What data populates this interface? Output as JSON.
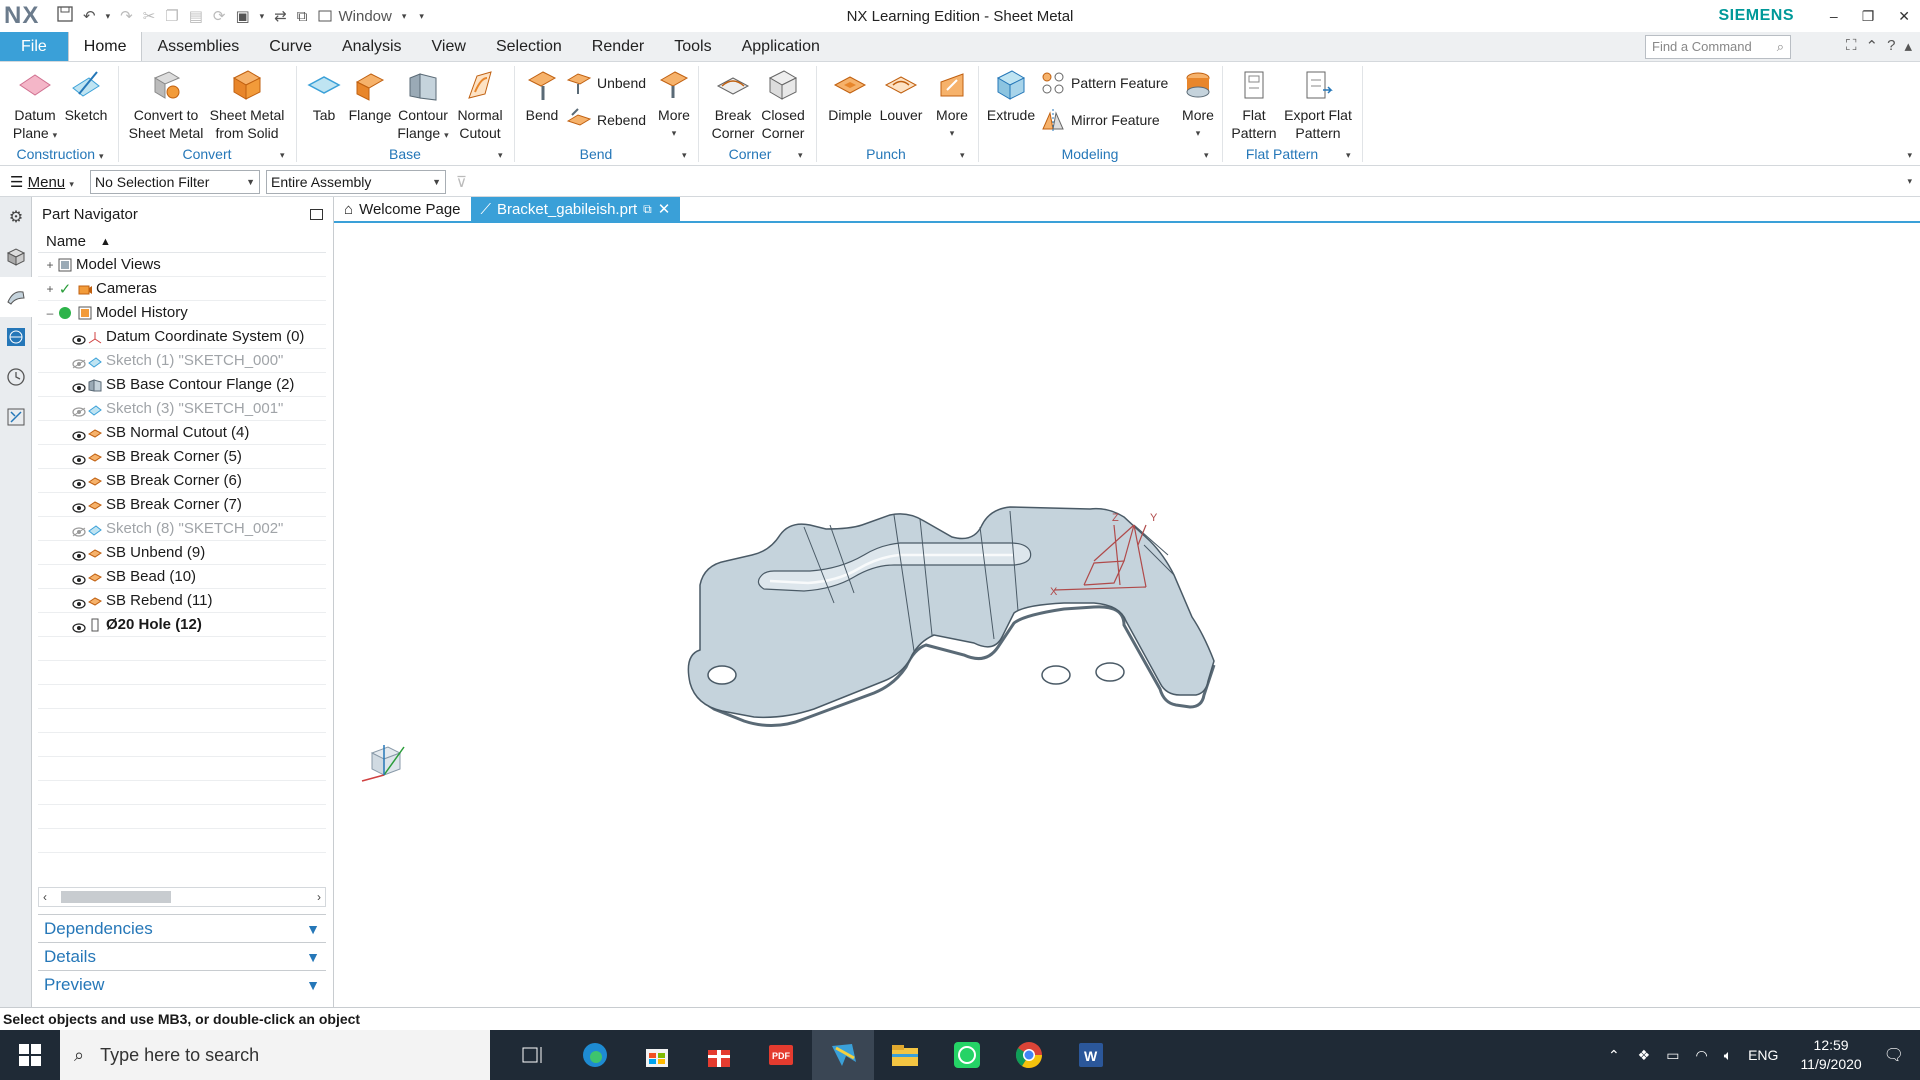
{
  "window": {
    "logo": "NX",
    "title": "NX Learning Edition - Sheet Metal",
    "brand": "SIEMENS",
    "window_menu_label": "Window"
  },
  "ribbon_tabs": [
    "File",
    "Home",
    "Assemblies",
    "Curve",
    "Analysis",
    "View",
    "Selection",
    "Render",
    "Tools",
    "Application"
  ],
  "active_tab": "Home",
  "find_command_placeholder": "Find a Command",
  "ribbon": {
    "datum_plane": [
      "Datum",
      "Plane"
    ],
    "sketch": "Sketch",
    "convert_to_sheet_metal": [
      "Convert to",
      "Sheet Metal"
    ],
    "sheet_metal_from_solid": [
      "Sheet Metal",
      "from Solid"
    ],
    "tab": "Tab",
    "flange": "Flange",
    "contour_flange": [
      "Contour",
      "Flange"
    ],
    "normal_cutout": [
      "Normal",
      "Cutout"
    ],
    "bend": "Bend",
    "unbend": "Unbend",
    "rebend": "Rebend",
    "more": "More",
    "break_corner": [
      "Break",
      "Corner"
    ],
    "closed_corner": [
      "Closed",
      "Corner"
    ],
    "dimple": "Dimple",
    "louver": "Louver",
    "extrude": "Extrude",
    "pattern_feature": "Pattern Feature",
    "mirror_feature": "Mirror Feature",
    "flat_pattern": [
      "Flat",
      "Pattern"
    ],
    "export_flat_pattern": [
      "Export Flat",
      "Pattern"
    ],
    "groups": [
      "Construction",
      "Convert",
      "Base",
      "Bend",
      "Corner",
      "Punch",
      "Modeling",
      "Flat Pattern"
    ]
  },
  "selection_bar": {
    "menu_label": "Menu",
    "selection_filter": "No Selection Filter",
    "scope": "Entire Assembly"
  },
  "navigator": {
    "title": "Part Navigator",
    "column_name": "Name",
    "top_nodes": [
      "Model Views",
      "Cameras",
      "Model History"
    ],
    "history": [
      {
        "label": "Datum Coordinate System (0)",
        "dim": false,
        "bold": false
      },
      {
        "label": "Sketch (1) \"SKETCH_000\"",
        "dim": true,
        "bold": false
      },
      {
        "label": "SB Base Contour Flange (2)",
        "dim": false,
        "bold": false
      },
      {
        "label": "Sketch (3) \"SKETCH_001\"",
        "dim": true,
        "bold": false
      },
      {
        "label": "SB Normal Cutout (4)",
        "dim": false,
        "bold": false
      },
      {
        "label": "SB Break Corner (5)",
        "dim": false,
        "bold": false
      },
      {
        "label": "SB Break Corner (6)",
        "dim": false,
        "bold": false
      },
      {
        "label": "SB Break Corner (7)",
        "dim": false,
        "bold": false
      },
      {
        "label": "Sketch (8) \"SKETCH_002\"",
        "dim": true,
        "bold": false
      },
      {
        "label": "SB Unbend (9)",
        "dim": false,
        "bold": false
      },
      {
        "label": "SB Bead (10)",
        "dim": false,
        "bold": false
      },
      {
        "label": "SB Rebend (11)",
        "dim": false,
        "bold": false
      },
      {
        "label": "Ø20 Hole (12)",
        "dim": false,
        "bold": true
      }
    ],
    "panels": [
      "Dependencies",
      "Details",
      "Preview"
    ]
  },
  "graphics_tabs": [
    "Welcome Page",
    "Bracket_gabileish.prt"
  ],
  "status_text": "Select objects and use MB3, or double-click an object",
  "taskbar": {
    "search_placeholder": "Type here to search",
    "language": "ENG",
    "time": "12:59",
    "date": "11/9/2020"
  },
  "colors": {
    "accent": "#3aa0d8",
    "brand": "#009999",
    "group_label": "#2577b8",
    "part_fill": "#c5d3dc",
    "taskbar": "#1f2a36"
  }
}
